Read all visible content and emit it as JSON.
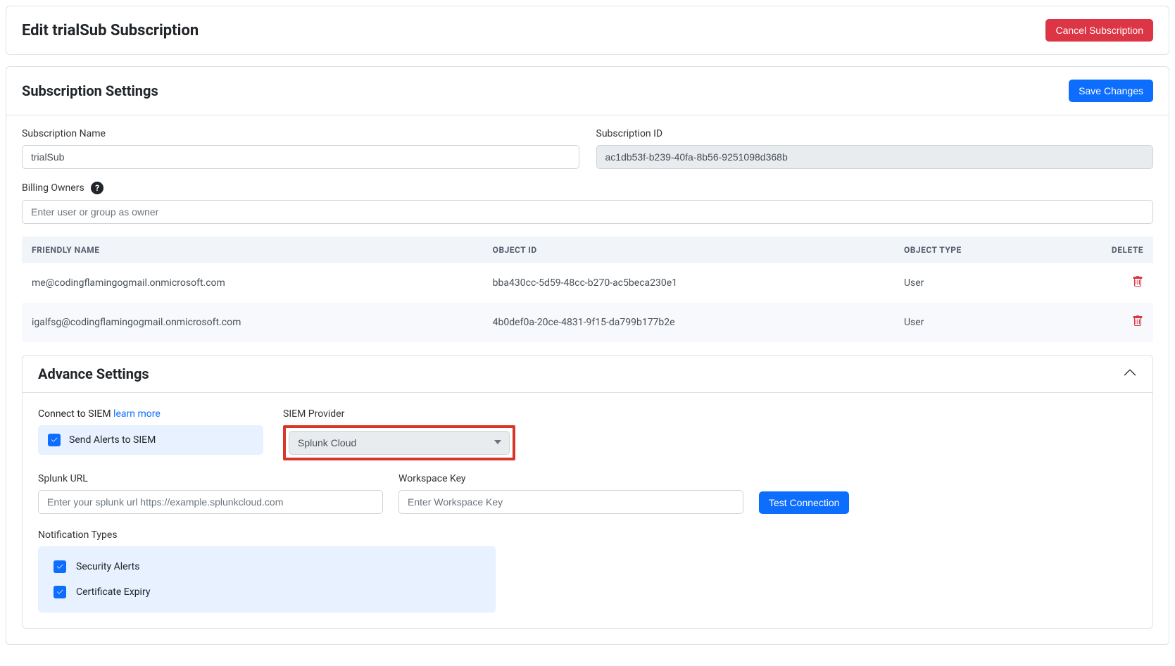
{
  "header": {
    "title": "Edit trialSub Subscription",
    "cancel_label": "Cancel Subscription"
  },
  "settings": {
    "title": "Subscription Settings",
    "save_label": "Save Changes",
    "name_label": "Subscription Name",
    "name_value": "trialSub",
    "id_label": "Subscription ID",
    "id_value": "ac1db53f-b239-40fa-8b56-9251098d368b",
    "billing_label": "Billing Owners",
    "billing_placeholder": "Enter user or group as owner"
  },
  "table": {
    "col_friendly": "FRIENDLY NAME",
    "col_object_id": "OBJECT ID",
    "col_object_type": "OBJECT TYPE",
    "col_delete": "DELETE",
    "rows": [
      {
        "friendly": "me@codingflamingogmail.onmicrosoft.com",
        "object_id": "bba430cc-5d59-48cc-b270-ac5beca230e1",
        "object_type": "User"
      },
      {
        "friendly": "igalfsg@codingflamingogmail.onmicrosoft.com",
        "object_id": "4b0def0a-20ce-4831-9f15-da799b177b2e",
        "object_type": "User"
      }
    ]
  },
  "advance": {
    "title": "Advance Settings",
    "connect_label": "Connect to SIEM ",
    "learn_more": "learn more",
    "send_alerts_label": "Send Alerts to SIEM",
    "provider_label": "SIEM Provider",
    "provider_value": "Splunk Cloud",
    "splunk_url_label": "Splunk URL",
    "splunk_url_placeholder": "Enter your splunk url https://example.splunkcloud.com",
    "workspace_key_label": "Workspace Key",
    "workspace_key_placeholder": "Enter Workspace Key",
    "test_connection_label": "Test Connection",
    "notif_label": "Notification Types",
    "notif_security": "Security Alerts",
    "notif_cert": "Certificate Expiry"
  }
}
